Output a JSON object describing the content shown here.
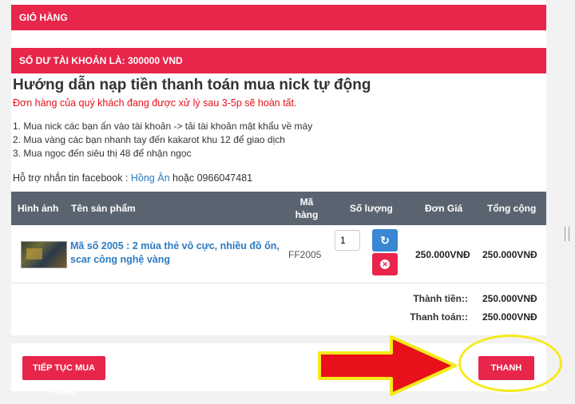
{
  "cart_header": "Giỏ hàng",
  "balance": "Số dư tài khoản là: 300000 VND",
  "guide": {
    "title": "Hướng dẫn nạp tiền thanh toán mua nick tự động",
    "notice": "Đơn hàng của quý khách đang được xử lý sau 3-5p sẽ hoàn tất.",
    "steps": [
      "1. Mua nick các bạn ấn vào tài khoản -> tải tài khoản mật khẩu về máy",
      "2. Mua vàng các bạn nhanh tay đến kakarot khu 12 để giao dịch",
      "3. Mua ngọc đến siêu thị 48 để nhận ngọc"
    ],
    "support_prefix": "Hỗ trợ nhắn tin facebook : ",
    "support_link": "Hồng Ân",
    "support_suffix": " hoặc 0966047481"
  },
  "table": {
    "headers": {
      "image": "Hình ảnh",
      "product": "Tên sản phẩm",
      "sku_line1": "Mã",
      "sku_line2": "hàng",
      "qty": "Số lượng",
      "unit_price": "Đơn Giá",
      "total": "Tổng cộng"
    },
    "row": {
      "name": "Mã số 2005 : 2 mùa thẻ vô cực, nhiều đồ ốn, scar công nghệ vàng",
      "sku": "FF2005",
      "qty": "1",
      "unit_price": "250.000VNĐ",
      "total": "250.000VNĐ"
    }
  },
  "summary": {
    "subtotal_label": "Thành tiền::",
    "subtotal_value": "250.000VNĐ",
    "payment_label": "Thanh toán::",
    "payment_value": "250.000VNĐ"
  },
  "buttons": {
    "continue": "Tiếp tục mua hàng",
    "checkout": "Thanh toán"
  },
  "colors": {
    "accent": "#e8254a",
    "header_bg": "#5a6470",
    "link": "#2b7bc1",
    "annotation_arrow": "#e8101a",
    "annotation_outline": "#f6ea1a"
  },
  "icons": {
    "refresh": "refresh-icon",
    "remove": "remove-icon"
  }
}
